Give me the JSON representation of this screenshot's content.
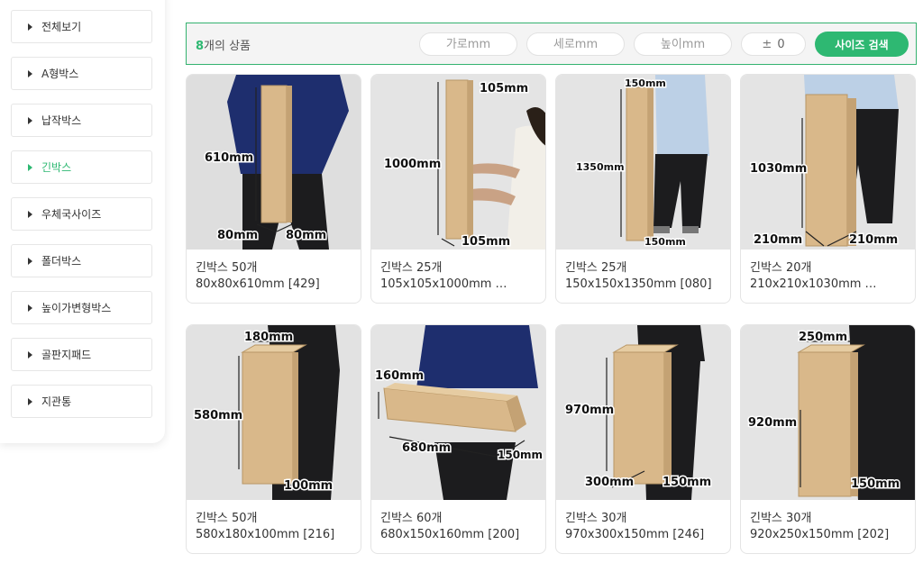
{
  "sidebar": {
    "items": [
      {
        "label": "전체보기",
        "active": false
      },
      {
        "label": "A형박스",
        "active": false
      },
      {
        "label": "납작박스",
        "active": false
      },
      {
        "label": "긴박스",
        "active": true
      },
      {
        "label": "우체국사이즈",
        "active": false
      },
      {
        "label": "폴더박스",
        "active": false
      },
      {
        "label": "높이가변형박스",
        "active": false
      },
      {
        "label": "골판지패드",
        "active": false
      },
      {
        "label": "지관통",
        "active": false
      }
    ]
  },
  "search": {
    "count_number": "8",
    "count_suffix": "개의 상품",
    "width_placeholder": "가로mm",
    "depth_placeholder": "세로mm",
    "height_placeholder": "높이mm",
    "tolerance_symbol": "±",
    "tolerance_value": "0",
    "button_label": "사이즈 검색"
  },
  "products": [
    {
      "name": "긴박스 50개",
      "dims": "80x80x610mm [429]",
      "labels": [
        "610mm",
        "80mm",
        "80mm"
      ]
    },
    {
      "name": "긴박스 25개",
      "dims": "105x105x1000mm …",
      "labels": [
        "105mm",
        "1000mm",
        "105mm"
      ]
    },
    {
      "name": "긴박스 25개",
      "dims": "150x150x1350mm [080]",
      "labels": [
        "150mm",
        "1350mm",
        "150mm"
      ]
    },
    {
      "name": "긴박스 20개",
      "dims": "210x210x1030mm …",
      "labels": [
        "1030mm",
        "210mm",
        "210mm"
      ]
    },
    {
      "name": "긴박스 50개",
      "dims": "580x180x100mm [216]",
      "labels": [
        "180mm",
        "580mm",
        "100mm"
      ]
    },
    {
      "name": "긴박스 60개",
      "dims": "680x150x160mm [200]",
      "labels": [
        "160mm",
        "680mm",
        "150mm"
      ]
    },
    {
      "name": "긴박스 30개",
      "dims": "970x300x150mm [246]",
      "labels": [
        "970mm",
        "300mm",
        "150mm"
      ]
    },
    {
      "name": "긴박스 30개",
      "dims": "920x250x150mm [202]",
      "labels": [
        "250mm",
        "920mm",
        "150mm"
      ]
    }
  ],
  "colors": {
    "accent": "#2eb872",
    "cardboard": "#d9b88a",
    "shirt_navy": "#1e2e6e",
    "shirt_lightblue": "#bcd0e6",
    "pants_black": "#1c1c1e"
  }
}
